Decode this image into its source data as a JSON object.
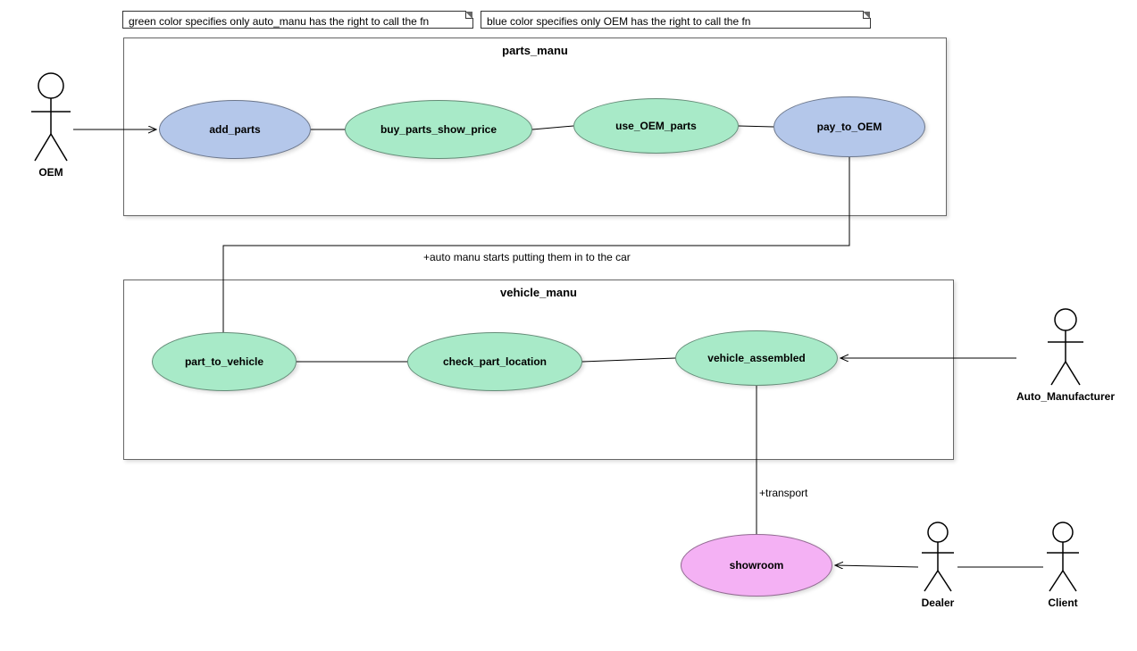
{
  "notes": {
    "green": "green color specifies only auto_manu has the right to call the fn",
    "blue": "blue color specifies only OEM has the right to call the fn"
  },
  "systems": {
    "parts_manu": {
      "title": "parts_manu"
    },
    "vehicle_manu": {
      "title": "vehicle_manu"
    }
  },
  "usecases": {
    "add_parts": "add_parts",
    "buy_parts_show_price": "buy_parts_show_price",
    "use_OEM_parts": "use_OEM_parts",
    "pay_to_OEM": "pay_to_OEM",
    "part_to_vehicle": "part_to_vehicle",
    "check_part_location": "check_part_location",
    "vehicle_assembled": "vehicle_assembled",
    "showroom": "showroom"
  },
  "actors": {
    "oem": "OEM",
    "auto_manu": "Auto_Manufacturer",
    "dealer": "Dealer",
    "client": "Client"
  },
  "edge_labels": {
    "assembly": "+auto manu starts putting them in to the car",
    "transport": "+transport"
  },
  "colors": {
    "blue": "#b4c7ea",
    "green": "#a8eac8",
    "pink": "#f4b1f4"
  },
  "chart_data": {
    "type": "use-case-diagram",
    "actors": [
      "OEM",
      "Auto_Manufacturer",
      "Dealer",
      "Client"
    ],
    "systems": [
      {
        "name": "parts_manu",
        "usecases": [
          {
            "name": "add_parts",
            "color": "blue"
          },
          {
            "name": "buy_parts_show_price",
            "color": "green"
          },
          {
            "name": "use_OEM_parts",
            "color": "green"
          },
          {
            "name": "pay_to_OEM",
            "color": "blue"
          }
        ]
      },
      {
        "name": "vehicle_manu",
        "usecases": [
          {
            "name": "part_to_vehicle",
            "color": "green"
          },
          {
            "name": "check_part_location",
            "color": "green"
          },
          {
            "name": "vehicle_assembled",
            "color": "green"
          }
        ]
      }
    ],
    "free_usecases": [
      {
        "name": "showroom",
        "color": "pink"
      }
    ],
    "associations": [
      {
        "from": "OEM",
        "to": "add_parts",
        "arrow": true
      },
      {
        "from": "add_parts",
        "to": "buy_parts_show_price",
        "arrow": false
      },
      {
        "from": "buy_parts_show_price",
        "to": "use_OEM_parts",
        "arrow": false
      },
      {
        "from": "use_OEM_parts",
        "to": "pay_to_OEM",
        "arrow": false
      },
      {
        "from": "pay_to_OEM",
        "to": "part_to_vehicle",
        "arrow": false,
        "label": "+auto manu starts putting them in to the car"
      },
      {
        "from": "part_to_vehicle",
        "to": "check_part_location",
        "arrow": false
      },
      {
        "from": "check_part_location",
        "to": "vehicle_assembled",
        "arrow": false
      },
      {
        "from": "Auto_Manufacturer",
        "to": "vehicle_assembled",
        "arrow": true
      },
      {
        "from": "vehicle_assembled",
        "to": "showroom",
        "arrow": false,
        "label": "+transport"
      },
      {
        "from": "Dealer",
        "to": "showroom",
        "arrow": true
      },
      {
        "from": "Client",
        "to": "Dealer",
        "arrow": false
      }
    ],
    "legend_notes": [
      "green color specifies only auto_manu has the right to call the fn",
      "blue color specifies only OEM has the right to call the fn"
    ]
  }
}
